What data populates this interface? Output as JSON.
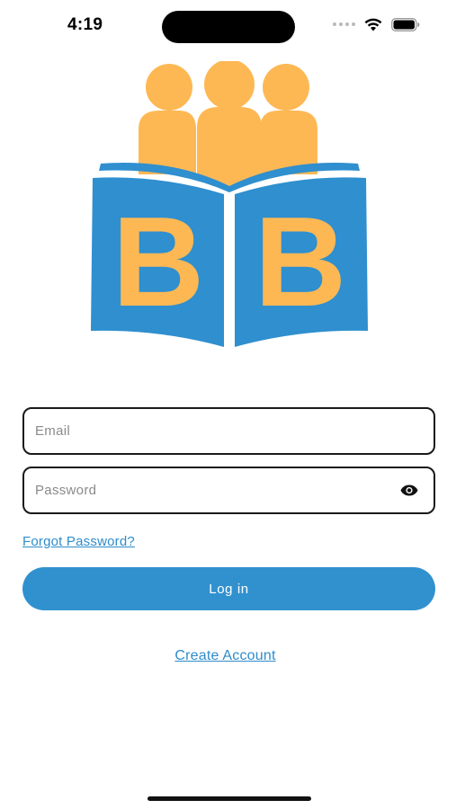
{
  "status_bar": {
    "time": "4:19",
    "icons": [
      "signal-dots-icon",
      "wifi-icon",
      "battery-icon"
    ]
  },
  "logo": {
    "letters": [
      "B",
      "B"
    ],
    "colors": {
      "people": "#FDB854",
      "book": "#2F8FCF",
      "letters": "#FDB854"
    }
  },
  "form": {
    "email": {
      "placeholder": "Email",
      "value": ""
    },
    "password": {
      "placeholder": "Password",
      "value": "",
      "toggle_icon": "eye-icon"
    },
    "forgot_password": "Forgot Password?",
    "login_label": "Log in",
    "create_account": "Create Account"
  },
  "colors": {
    "accent": "#3191CF",
    "link": "#2E8CCB",
    "field_border": "#1A1A1A"
  }
}
